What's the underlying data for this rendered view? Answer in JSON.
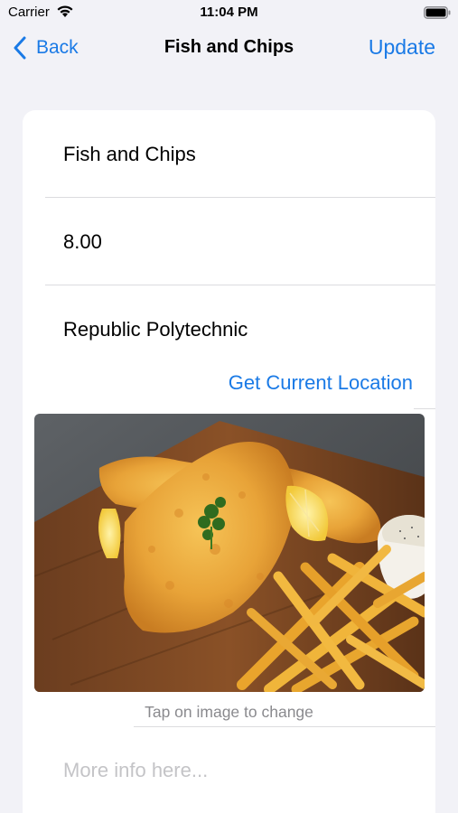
{
  "status_bar": {
    "carrier": "Carrier",
    "time": "11:04 PM"
  },
  "nav": {
    "back_label": "Back",
    "title": "Fish and Chips",
    "update_label": "Update"
  },
  "form": {
    "name": "Fish and Chips",
    "price": "8.00",
    "location": "Republic Polytechnic",
    "get_location_label": "Get Current Location",
    "image_hint": "Tap on image to change",
    "more_info_placeholder": "More info here..."
  },
  "colors": {
    "accent": "#1a7ae6",
    "background": "#f2f2f7",
    "card": "#ffffff"
  }
}
